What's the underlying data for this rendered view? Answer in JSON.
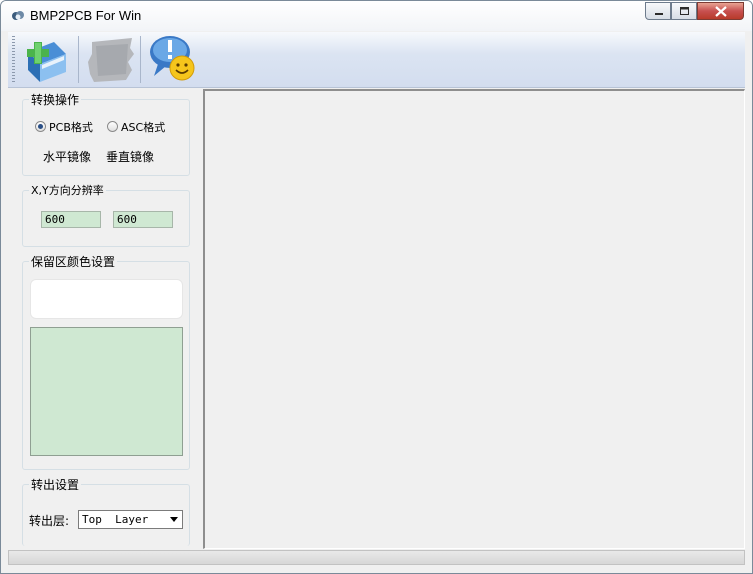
{
  "window": {
    "title": "BMP2PCB For Win"
  },
  "toolbar": {
    "buttons": [
      "convert-icon",
      "disabled-tool-icon",
      "help-smiley-icon"
    ]
  },
  "conversion": {
    "group_label": "转换操作",
    "radio_pcb": "PCB格式",
    "radio_asc": "ASC格式",
    "selected": "PCB格式",
    "mirror_h": "水平镜像",
    "mirror_v": "垂直镜像"
  },
  "resolution": {
    "group_label": "X,Y方向分辨率",
    "x_value": "600",
    "y_value": "600"
  },
  "color": {
    "group_label": "保留区颜色设置",
    "swatch_color": "#cfe8d2"
  },
  "output": {
    "group_label": "转出设置",
    "layer_label": "转出层:",
    "layer_value": "Top  Layer"
  }
}
